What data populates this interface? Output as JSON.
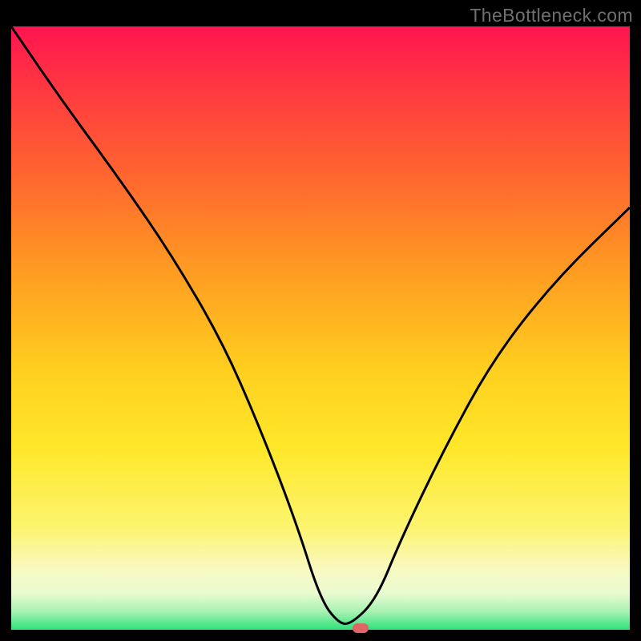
{
  "watermark": "TheBottleneck.com",
  "chart_data": {
    "type": "line",
    "title": "",
    "xlabel": "",
    "ylabel": "",
    "xlim": [
      0,
      100
    ],
    "ylim": [
      0,
      100
    ],
    "series": [
      {
        "name": "bottleneck-curve",
        "x": [
          0,
          8,
          18,
          26,
          34,
          40,
          46,
          50,
          53,
          55,
          59,
          63,
          70,
          78,
          88,
          100
        ],
        "values": [
          100,
          88,
          74,
          62,
          48,
          34,
          18,
          5,
          1,
          1,
          5,
          15,
          30,
          45,
          58,
          70
        ]
      }
    ],
    "marker": {
      "x": 56.5,
      "y": 0
    },
    "colors": {
      "top": "#ff1450",
      "bottom": "#2ee27a",
      "curve": "#000000",
      "marker": "#e06666"
    }
  }
}
